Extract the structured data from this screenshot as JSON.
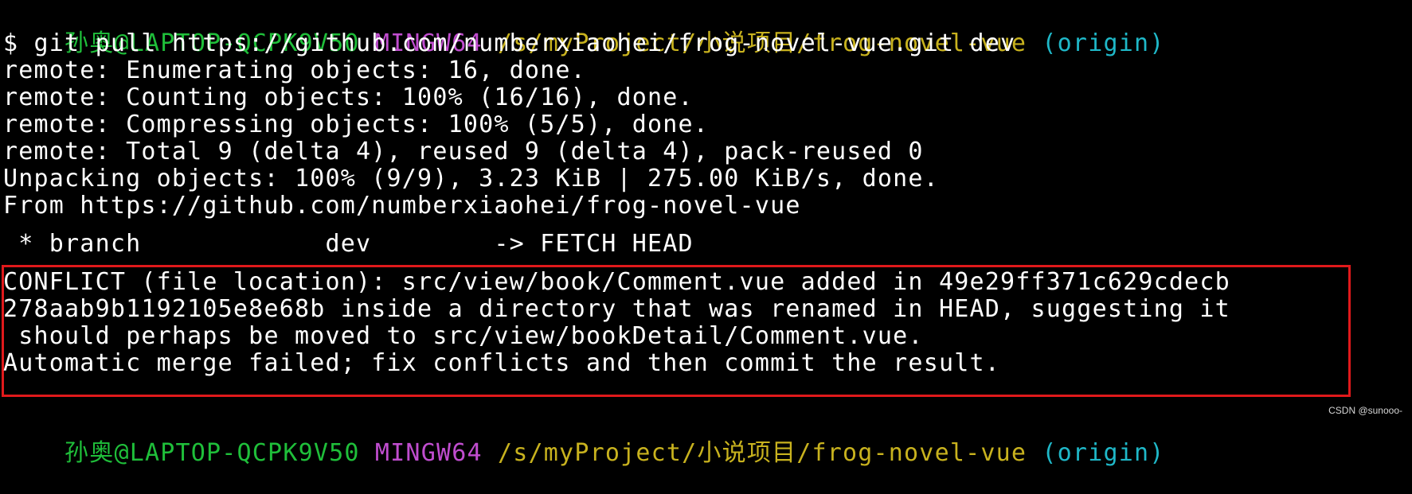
{
  "prompt": {
    "user_host": "孙奥@LAPTOP-QCPK9V50",
    "env": "MINGW64",
    "path": "/s/myProject/小说项目/frog-novel-vue",
    "branch": "(origin)",
    "colors": {
      "user_host": "#1fbf3a",
      "env": "#c04dcf",
      "path": "#c8b21e",
      "branch": "#1fb8c8"
    }
  },
  "command": "$ git pull https://github.com/numberxiaohei/frog-novel-vue.git dev",
  "output_lines": [
    "remote: Enumerating objects: 16, done.",
    "remote: Counting objects: 100% (16/16), done.",
    "remote: Compressing objects: 100% (5/5), done.",
    "remote: Total 9 (delta 4), reused 9 (delta 4), pack-reused 0",
    "Unpacking objects: 100% (9/9), 3.23 KiB | 275.00 KiB/s, done.",
    "From https://github.com/numberxiaohei/frog-novel-vue",
    " * branch            dev        -> FETCH_HEAD"
  ],
  "conflict_lines": [
    "CONFLICT (file location): src/view/book/Comment.vue added in 49e29ff371c629cdecb",
    "278aab9b1192105e8e68b inside a directory that was renamed in HEAD, suggesting it",
    " should perhaps be moved to src/view/bookDetail/Comment.vue.",
    "Automatic merge failed; fix conflicts and then commit the result."
  ],
  "highlight_color": "#e0191b",
  "watermark": "CSDN @sunooo-"
}
